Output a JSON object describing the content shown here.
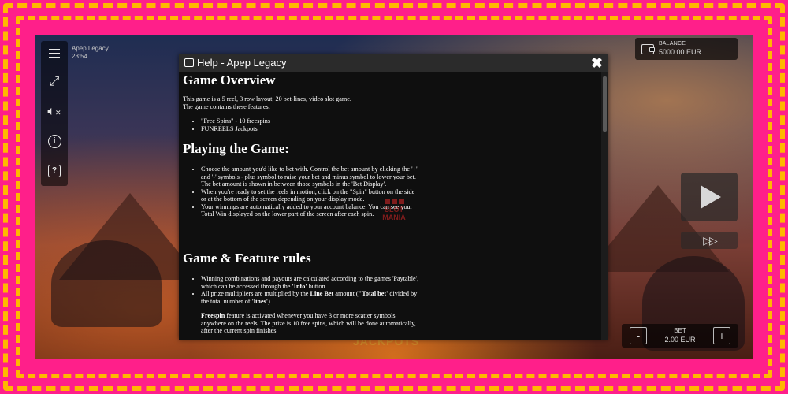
{
  "game": {
    "name": "Apep Legacy",
    "clock": "23:54",
    "jackpots_text": "JACKPOTS"
  },
  "toolbar": {
    "icons": [
      "menu-icon",
      "fullscreen-icon",
      "sound-muted-icon",
      "info-icon",
      "help-icon"
    ]
  },
  "balance": {
    "label": "BALANCE",
    "value": "5000.00 EUR"
  },
  "bet": {
    "label": "BET",
    "value": "2.00 EUR",
    "minus": "-",
    "plus": "+"
  },
  "controls": {
    "turbo_glyph": "▷▷"
  },
  "watermark": {
    "line1": "SLOT",
    "line2": "MANIA"
  },
  "dialog": {
    "title": "Help - Apep Legacy",
    "close": "✖",
    "sections": {
      "overview": {
        "heading": "Game Overview",
        "para1": "This game is a 5 reel, 3 row layout, 20 bet-lines, video slot game.",
        "para2": "The game contains these features:",
        "items": [
          "\"Free Spins\" - 10 freespins",
          "FUNREELS Jackpots"
        ]
      },
      "playing": {
        "heading": "Playing the Game:",
        "items": [
          "Choose the amount you'd like to bet with. Control the bet amount by clicking the '+' and '-' symbols - plus symbol to raise your bet and minus symbol to lower your bet. The bet amount is shown in between those symbols in the 'Bet Display'.",
          "When you're ready to set the reels in motion, click on the \"Spin\" button on the side or at the bottom of the screen depending on your display mode.",
          "Your winnings are automatically added to your account balance. You can see your Total Win displayed on the lower part of the screen after each spin."
        ]
      },
      "rules": {
        "heading": "Game & Feature rules",
        "item1_text": "Winning combinations and payouts are calculated according to the games 'Paytable', which can be accessed through the ",
        "item1_bold": "'Info'",
        "item1_end": " button.",
        "item2_a": "All prize multipliers are multiplied by the ",
        "item2_b": "Line Bet",
        "item2_c": " amount (",
        "item2_d": "\"Total bet'",
        "item2_e": " divided by the total number of ",
        "item2_f": "'lines'",
        "item2_g": ").",
        "freespin_bold": "Freespin",
        "freespin_text": " feature is activated whenever you have 3 or more scatter symbols anywhere on the reels. The prize is 10 free spins, which will be done automatically, after the current spin finishes."
      }
    }
  },
  "colors": {
    "frame_bg": "#ff1f8a",
    "frame_dash": "#ffb800",
    "dialog_bg": "#0f0f0f",
    "dialog_header": "#2b2b2b"
  }
}
